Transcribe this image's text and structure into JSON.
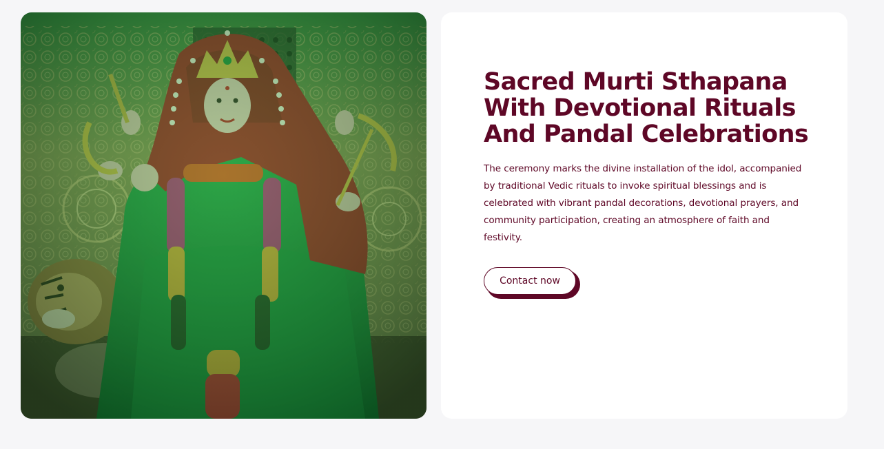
{
  "hero_image": {
    "alt": "Decorated idol of the goddess in a green saree seated on a tiger"
  },
  "content": {
    "heading_lines": [
      "Sacred Murti Sthapana",
      "With Devotional Rituals",
      "And Pandal Celebrations"
    ],
    "description": "The ceremony marks the divine installation of the idol, accompanied by traditional Vedic rituals to invoke spiritual blessings and is celebrated with vibrant pandal decorations, devotional prayers, and community participation, creating an atmosphere of faith and festivity.",
    "cta_label": "Contact now"
  },
  "colors": {
    "brand": "#5e0726",
    "page_bg": "#f6f6f8",
    "card_bg": "#ffffff"
  }
}
